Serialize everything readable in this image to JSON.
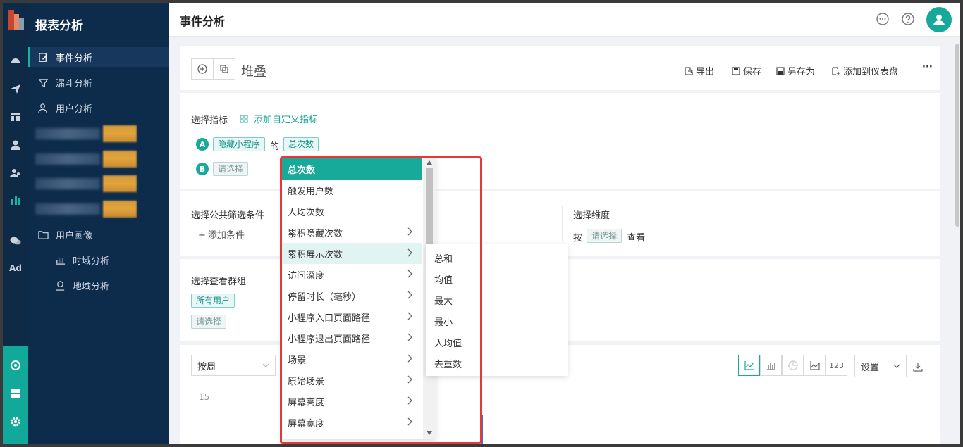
{
  "sidebar": {
    "brand": "报表分析",
    "items": [
      {
        "label": "事件分析"
      },
      {
        "label": "漏斗分析"
      },
      {
        "label": "用户分析"
      },
      {
        "label": "用户画像"
      },
      {
        "label": "时域分析"
      },
      {
        "label": "地域分析"
      }
    ]
  },
  "rail": {
    "ad_label": "Ad"
  },
  "header": {
    "title": "事件分析"
  },
  "toolbar": {
    "chart_title": "堆叠",
    "export": "导出",
    "save": "保存",
    "save_as": "另存为",
    "add_dashboard": "添加到仪表盘",
    "more": "···"
  },
  "metrics": {
    "label": "选择指标",
    "add_custom": "添加自定义指标",
    "row_a": {
      "badge": "A",
      "event": "隐藏小程序",
      "of": "的",
      "metric": "总次数"
    },
    "row_b": {
      "badge": "B",
      "placeholder": "请选择"
    }
  },
  "filters": {
    "label": "选择公共筛选条件",
    "add_condition": "添加条件",
    "dimension_label": "选择维度",
    "by": "按",
    "dimension_placeholder": "请选择",
    "view": "查看"
  },
  "groups": {
    "label": "选择查看群组",
    "all_users": "所有用户",
    "placeholder": "请选择"
  },
  "chart": {
    "period": "按周",
    "view_number_label": "123",
    "settings": "设置",
    "y_tick": "15"
  },
  "dropdown": {
    "items": [
      {
        "label": "总次数",
        "submenu": false
      },
      {
        "label": "触发用户数",
        "submenu": false
      },
      {
        "label": "人均次数",
        "submenu": false
      },
      {
        "label": "累积隐藏次数",
        "submenu": true
      },
      {
        "label": "累积展示次数",
        "submenu": true
      },
      {
        "label": "访问深度",
        "submenu": true
      },
      {
        "label": "停留时长（毫秒）",
        "submenu": true
      },
      {
        "label": "小程序入口页面路径",
        "submenu": true
      },
      {
        "label": "小程序退出页面路径",
        "submenu": true
      },
      {
        "label": "场景",
        "submenu": true
      },
      {
        "label": "原始场景",
        "submenu": true
      },
      {
        "label": "屏幕高度",
        "submenu": true
      },
      {
        "label": "屏幕宽度",
        "submenu": true
      }
    ],
    "submenu": [
      "总和",
      "均值",
      "最大",
      "最小",
      "人均值",
      "去重数"
    ]
  },
  "colors": {
    "accent": "#17a99a",
    "sidebar_bg": "#0d2b4b",
    "highlight_frame": "#e53935"
  }
}
